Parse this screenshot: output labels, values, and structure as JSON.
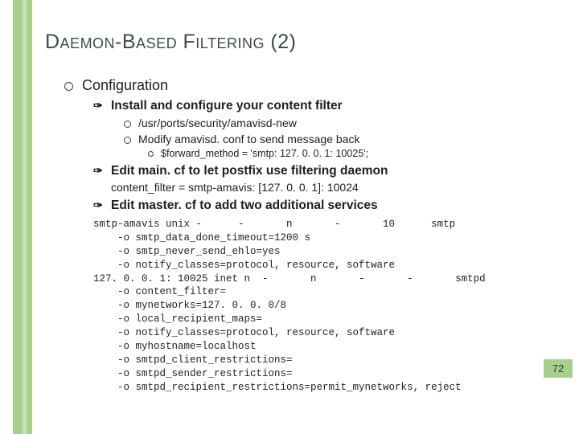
{
  "title": "Daemon-Based Filtering (2)",
  "page_number": "72",
  "bullets": {
    "configuration": "Configuration",
    "install": "Install and configure your content filter",
    "path": "/usr/ports/security/amavisd-new",
    "modify": "Modify amavisd. conf to send message back",
    "forward": "$forward_method = 'smtp: 127. 0. 0. 1: 10025';",
    "editmain": "Edit main. cf to let postfix use filtering daemon",
    "contentfilter": "content_filter = smtp-amavis: [127. 0. 0. 1]: 10024",
    "editmaster": "Edit master. cf to add two additional services"
  },
  "code": "smtp-amavis unix -      -       n       -       10      smtp\n    -o smtp_data_done_timeout=1200 s\n    -o smtp_never_send_ehlo=yes\n    -o notify_classes=protocol, resource, software\n127. 0. 0. 1: 10025 inet n  -       n       -       -       smtpd\n    -o content_filter=\n    -o mynetworks=127. 0. 0. 0/8\n    -o local_recipient_maps=\n    -o notify_classes=protocol, resource, software\n    -o myhostname=localhost\n    -o smtpd_client_restrictions=\n    -o smtpd_sender_restrictions=\n    -o smtpd_recipient_restrictions=permit_mynetworks, reject"
}
